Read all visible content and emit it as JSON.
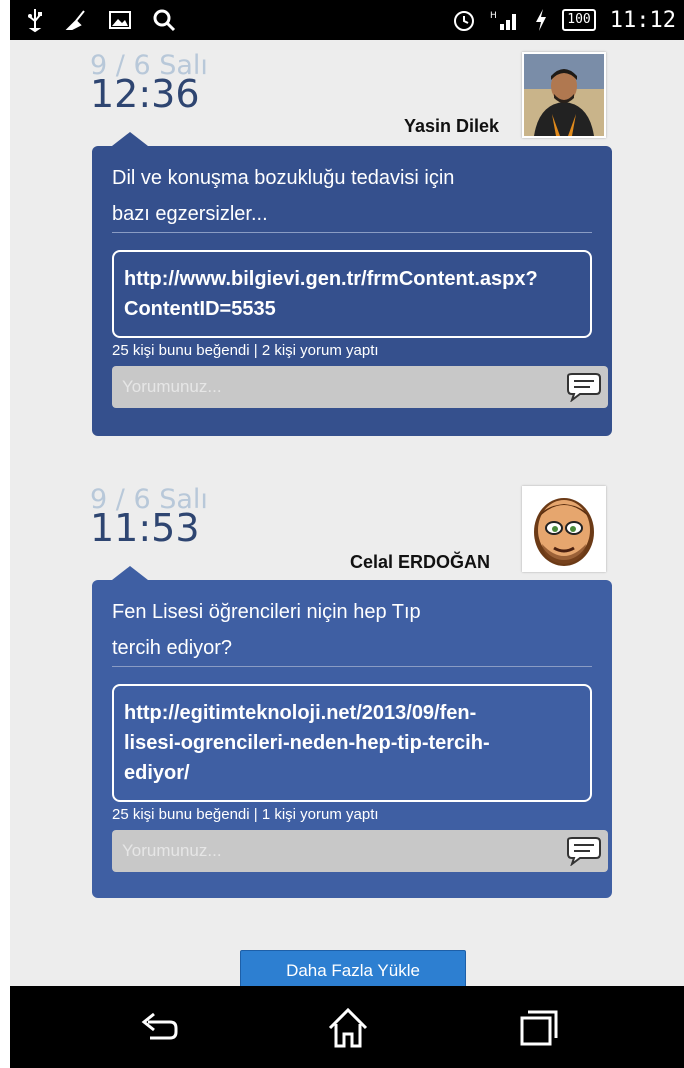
{
  "status_bar": {
    "time": "11:12",
    "battery": "100",
    "icons": [
      "usb-icon",
      "broom-icon",
      "image-icon",
      "search-icon",
      "alarm-icon",
      "signal-icon",
      "charging-icon",
      "battery-icon"
    ]
  },
  "posts": [
    {
      "date": "9 / 6 Salı",
      "time": "12:36",
      "author": "Yasin Dilek",
      "text_line1": "Dil ve konuşma bozukluğu tedavisi için",
      "text_line2": "bazı egzersizler...",
      "link_line1": "http://www.bilgievi.gen.tr/frmContent.aspx?",
      "link_line2": "ContentID=5535",
      "stats": "25 kişi bunu beğendi | 2 kişi yorum yaptı",
      "comment_placeholder": "Yorumunuz..."
    },
    {
      "date": "9 / 6 Salı",
      "time": "11:53",
      "author": "Celal ERDOĞAN",
      "text_line1": "Fen Lisesi öğrencileri niçin hep Tıp",
      "text_line2": "tercih ediyor?",
      "link_line1": "http://egitimteknoloji.net/2013/09/fen-",
      "link_line2": "lisesi-ogrencileri-neden-hep-tip-tercih-",
      "link_line3": "ediyor/",
      "stats": "25 kişi bunu beğendi | 1 kişi yorum yaptı",
      "comment_placeholder": "Yorumunuz..."
    }
  ],
  "load_more_label": "Daha Fazla Yükle",
  "nav": {
    "back": "back-icon",
    "home": "home-icon",
    "recents": "recents-icon"
  },
  "colors": {
    "card_1": "#35508d",
    "card_2": "#3f5fa3",
    "button": "#2d7fd1"
  }
}
